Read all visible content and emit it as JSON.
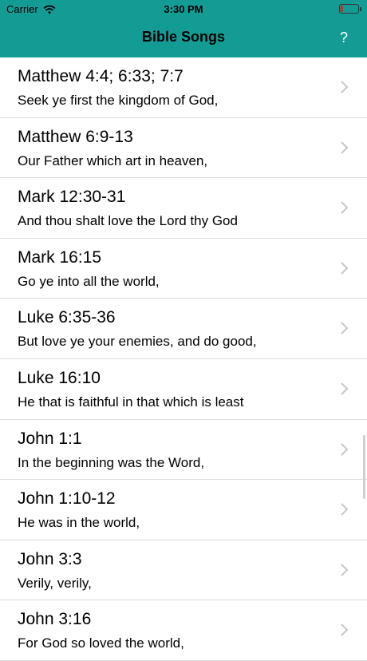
{
  "status": {
    "carrier": "Carrier",
    "time": "3:30 PM"
  },
  "nav": {
    "title": "Bible Songs",
    "help": "?"
  },
  "songs": [
    {
      "ref": "Matthew 4:4; 6:33; 7:7",
      "verse": "Seek ye first the kingdom of God,"
    },
    {
      "ref": "Matthew 6:9-13",
      "verse": "Our Father which art in heaven,"
    },
    {
      "ref": "Mark 12:30-31",
      "verse": "And thou shalt love the Lord thy God"
    },
    {
      "ref": "Mark 16:15",
      "verse": "Go ye into all the world,"
    },
    {
      "ref": "Luke 6:35-36",
      "verse": "But love ye your enemies, and do good,"
    },
    {
      "ref": "Luke 16:10",
      "verse": "He that is faithful in that which is least"
    },
    {
      "ref": "John 1:1",
      "verse": "In the beginning was the Word,"
    },
    {
      "ref": "John 1:10-12",
      "verse": "He was in the world,"
    },
    {
      "ref": "John 3:3",
      "verse": "Verily, verily,"
    },
    {
      "ref": "John 3:16",
      "verse": "For God so loved the world,"
    }
  ],
  "colors": {
    "header": "#139c94",
    "battery_low": "#e0201b"
  }
}
